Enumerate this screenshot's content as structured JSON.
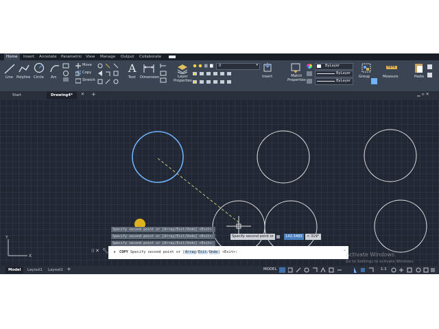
{
  "ribbon_tabs": [
    "Home",
    "Insert",
    "Annotate",
    "Parametric",
    "View",
    "Manage",
    "Output",
    "Collaborate"
  ],
  "draw_tools": [
    "Line",
    "Polyline",
    "Circle",
    "Arc"
  ],
  "modify_tools": [
    "Move",
    "Copy",
    "Stretch"
  ],
  "annotation": {
    "text": "Text",
    "dimension": "Dimension"
  },
  "layers": {
    "properties_label": "Layer\nProperties",
    "current_layer": "0"
  },
  "match_properties": "Match\nProperties",
  "properties": [
    "ByLayer",
    "ByLayer",
    "ByLayer"
  ],
  "insert_label": "Insert",
  "group_label": "Group",
  "measure_label": "Measure",
  "paste_label": "Paste",
  "doc_tabs": {
    "start": "Start",
    "drawing": "Drawing4*"
  },
  "command_history": [
    "Specify second point or [Array/Exit/Undo] <Exit>:",
    "Specify second point or [Array/Exit/Undo] <Exit>:",
    "Specify second point or [Array/Exit/Undo] <Exit>:"
  ],
  "command_line": {
    "command": "COPY",
    "prompt_a": "Specify second point or [",
    "opt_array": "Array",
    "opt_exit": "Exit",
    "opt_undo": "Undo",
    "prompt_b": "] <Exit>:"
  },
  "dynamic_input": {
    "prompt": "Specify second point or",
    "distance": "142.3485",
    "angle": "< 319°"
  },
  "layout_tabs": [
    "Model",
    "Layout1",
    "Layout2"
  ],
  "status": {
    "model": "MODEL",
    "scale": "1:1"
  },
  "watermark": {
    "title": "Activate Windows",
    "subtitle": "Go to Settings to activate Windows."
  },
  "colors": {
    "canvas": "#212733",
    "ribbon": "#3b4453",
    "selection": "#6fb3ff",
    "circle": "#e6e6e6",
    "rubberband": "#c8c97a"
  }
}
